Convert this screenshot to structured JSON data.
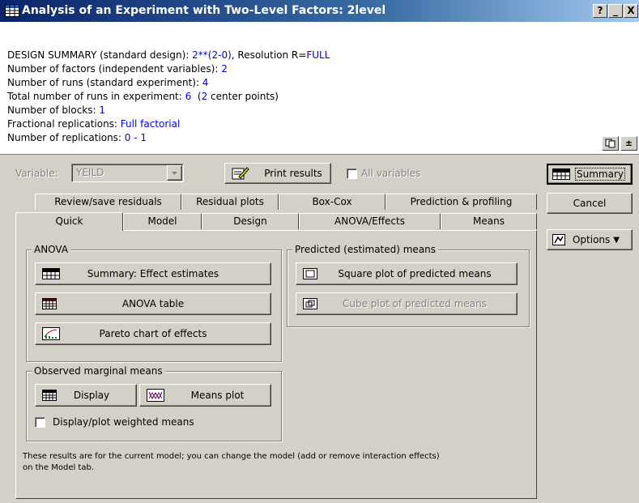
{
  "window": {
    "title": "Analysis of an Experiment with Two-Level Factors: 2level",
    "help_label": "?",
    "minimize_label": "_",
    "close_label": "X"
  },
  "summary": {
    "lines": [
      {
        "label": "DESIGN SUMMARY (standard design): ",
        "value": "2**(2-0)",
        "label2": ", Resolution R=",
        "value2": "FULL"
      },
      {
        "label": "Number of factors (independent variables): ",
        "value": "2"
      },
      {
        "label": "Number of runs (standard experiment): ",
        "value": "4"
      },
      {
        "label": "Total number of runs in experiment: ",
        "value": "6",
        "label2": "  (",
        "value2": "2",
        "label3": " center points)"
      },
      {
        "label": "Number of blocks: ",
        "value": "1"
      },
      {
        "label": "Fractional replications: ",
        "value": "Full factorial"
      },
      {
        "label": "Number of replications: ",
        "value": "0 - 1"
      }
    ],
    "copy_icon": "copy-icon",
    "expand_label": "±"
  },
  "toolbar": {
    "variable_label": "Variable:",
    "variable_value": "YEILD",
    "print_results_label": "Print results",
    "all_variables_label": "All variables"
  },
  "right_buttons": {
    "summary_label": "Summary",
    "cancel_label": "Cancel",
    "options_label": "Options"
  },
  "tabs": {
    "row1": [
      "Review/save residuals",
      "Residual plots",
      "Box-Cox",
      "Prediction & profiling"
    ],
    "row2": [
      "Quick",
      "Model",
      "Design",
      "ANOVA/Effects",
      "Means"
    ],
    "active": "Quick"
  },
  "anova_group": {
    "legend": "ANOVA",
    "summary_effect_estimates": "Summary:  Effect estimates",
    "anova_table": "ANOVA table",
    "pareto_chart": "Pareto chart of effects"
  },
  "predicted_group": {
    "legend": "Predicted (estimated) means",
    "square_plot": "Square plot of predicted means",
    "cube_plot": "Cube plot of predicted means"
  },
  "observed_group": {
    "legend": "Observed marginal means",
    "display": "Display",
    "means_plot": "Means plot",
    "weighted_means": "Display/plot weighted means"
  },
  "note": {
    "line1": "These results are for the current model; you can change the model (add or remove interaction effects)",
    "line2": "on the Model tab."
  },
  "colors": {
    "face": "#d4d0c8",
    "title_start": "#0a246a",
    "title_end": "#a6caf0",
    "value_blue": "#0000e0"
  }
}
